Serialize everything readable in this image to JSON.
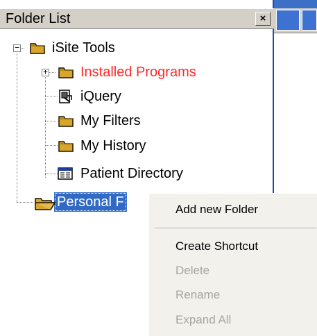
{
  "panel": {
    "title": "Folder List",
    "close_label": "×"
  },
  "tree": {
    "root": "iSite Tools",
    "items": [
      {
        "label": "Installed Programs",
        "icon": "folder-icon",
        "color": "#ff2a2a"
      },
      {
        "label": "iQuery",
        "icon": "iquery-icon"
      },
      {
        "label": "My Filters",
        "icon": "folder-icon"
      },
      {
        "label": "My History",
        "icon": "folder-icon"
      },
      {
        "label": "Patient Directory",
        "icon": "directory-icon"
      }
    ],
    "selected": "Personal F"
  },
  "context_menu": {
    "items": [
      {
        "label": "Add new Folder",
        "enabled": true
      },
      {
        "label": "Create Shortcut",
        "enabled": true
      },
      {
        "label": "Delete",
        "enabled": false
      },
      {
        "label": "Rename",
        "enabled": false
      },
      {
        "label": "Expand All",
        "enabled": false
      }
    ]
  },
  "colors": {
    "desktop": "#3c6fc6",
    "selection": "#316ac5",
    "header": "#d4d0c8",
    "disabled_text": "#a7a59f"
  }
}
